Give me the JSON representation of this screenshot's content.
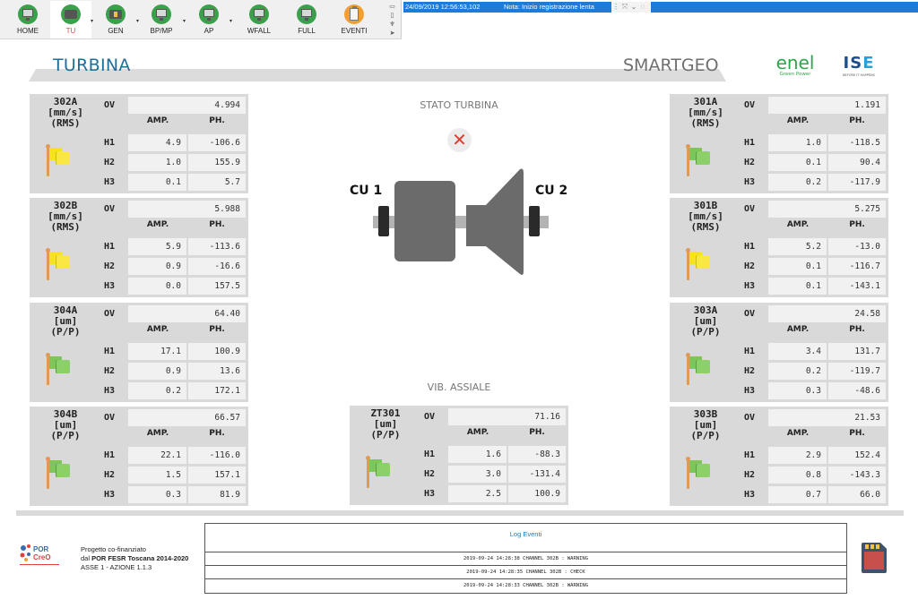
{
  "toolbar": {
    "buttons": [
      {
        "label": "HOME",
        "icon": "monitor-icon",
        "active": false,
        "dropdown": false
      },
      {
        "label": "TU",
        "icon": "turbine-icon",
        "active": true,
        "dropdown": true
      },
      {
        "label": "GEN",
        "icon": "generator-icon",
        "active": false,
        "dropdown": true
      },
      {
        "label": "BP/MP",
        "icon": "monitor-icon",
        "active": false,
        "dropdown": true
      },
      {
        "label": "AP",
        "icon": "monitor-icon",
        "active": false,
        "dropdown": true
      },
      {
        "label": "WFALL",
        "icon": "monitor-icon",
        "active": false,
        "dropdown": false
      },
      {
        "label": "FULL",
        "icon": "monitor-icon",
        "active": false,
        "dropdown": false
      },
      {
        "label": "EVENTI",
        "icon": "clipboard-icon",
        "active": false,
        "dropdown": false
      }
    ],
    "caret": "▾",
    "side_icons": [
      "keyboard-icon",
      "note-icon",
      "microphone-icon",
      "pointer-icon"
    ]
  },
  "statusbar": {
    "timestamp": "24/09/2019 12:56:53,102",
    "note": "Nota: Inizio registrazione lenta",
    "controls": [
      "grid-icon",
      "expand-icon",
      "chevron-down-icon",
      "chat-icon"
    ],
    "bg_color": "#1e7bd8"
  },
  "header": {
    "title": "TURBINA",
    "brand": "SMARTGEO",
    "enel_logo": "enel",
    "enel_sub": "Green Power",
    "ise_logo_a": "IS",
    "ise_logo_b": "E",
    "ise_sub": "BEFORE IT HAPPENS"
  },
  "labels": {
    "ov": "OV",
    "amp": "AMP.",
    "ph": "PH.",
    "h1": "H1",
    "h2": "H2",
    "h3": "H3"
  },
  "sensors": {
    "s302A": {
      "line1": "302A",
      "line2": "[mm/s]",
      "line3": "(RMS)",
      "flag": "yellow",
      "ov": "4.994",
      "h1_amp": "4.9",
      "h1_ph": "-106.6",
      "h2_amp": "1.0",
      "h2_ph": "155.9",
      "h3_amp": "0.1",
      "h3_ph": "5.7"
    },
    "s302B": {
      "line1": "302B",
      "line2": "[mm/s]",
      "line3": "(RMS)",
      "flag": "yellow",
      "ov": "5.988",
      "h1_amp": "5.9",
      "h1_ph": "-113.6",
      "h2_amp": "0.9",
      "h2_ph": "-16.6",
      "h3_amp": "0.0",
      "h3_ph": "157.5"
    },
    "s304A": {
      "line1": "304A",
      "line2": "[um]",
      "line3": "(P/P)",
      "flag": "green",
      "ov": "64.40",
      "h1_amp": "17.1",
      "h1_ph": "100.9",
      "h2_amp": "0.9",
      "h2_ph": "13.6",
      "h3_amp": "0.2",
      "h3_ph": "172.1"
    },
    "s304B": {
      "line1": "304B",
      "line2": "[um]",
      "line3": "(P/P)",
      "flag": "green",
      "ov": "66.57",
      "h1_amp": "22.1",
      "h1_ph": "-116.0",
      "h2_amp": "1.5",
      "h2_ph": "157.1",
      "h3_amp": "0.3",
      "h3_ph": "81.9"
    },
    "s301A": {
      "line1": "301A",
      "line2": "[mm/s]",
      "line3": "(RMS)",
      "flag": "green",
      "ov": "1.191",
      "h1_amp": "1.0",
      "h1_ph": "-118.5",
      "h2_amp": "0.1",
      "h2_ph": "90.4",
      "h3_amp": "0.2",
      "h3_ph": "-117.9"
    },
    "s301B": {
      "line1": "301B",
      "line2": "[mm/s]",
      "line3": "(RMS)",
      "flag": "yellow",
      "ov": "5.275",
      "h1_amp": "5.2",
      "h1_ph": "-13.0",
      "h2_amp": "0.1",
      "h2_ph": "-116.7",
      "h3_amp": "0.1",
      "h3_ph": "-143.1"
    },
    "s303A": {
      "line1": "303A",
      "line2": "[um]",
      "line3": "(P/P)",
      "flag": "green",
      "ov": "24.58",
      "h1_amp": "3.4",
      "h1_ph": "131.7",
      "h2_amp": "0.2",
      "h2_ph": "-119.7",
      "h3_amp": "0.3",
      "h3_ph": "-48.6"
    },
    "s303B": {
      "line1": "303B",
      "line2": "[um]",
      "line3": "(P/P)",
      "flag": "green",
      "ov": "21.53",
      "h1_amp": "2.9",
      "h1_ph": "152.4",
      "h2_amp": "0.8",
      "h2_ph": "-143.3",
      "h3_amp": "0.7",
      "h3_ph": "66.0"
    },
    "sZT301": {
      "line1": "ZT301",
      "line2": "[um]",
      "line3": "(P/P)",
      "flag": "green",
      "ov": "71.16",
      "h1_amp": "1.6",
      "h1_ph": "-88.3",
      "h2_amp": "3.0",
      "h2_ph": "-131.4",
      "h3_amp": "2.5",
      "h3_ph": "100.9"
    }
  },
  "center": {
    "stato_title": "STATO TURBINA",
    "stato_symbol": "✕",
    "stato_color": "#e53b2c",
    "cu1": "CU 1",
    "cu2": "CU 2",
    "vib_title": "VIB. ASSIALE"
  },
  "footer": {
    "por_line1": "Progetto co-finanziato",
    "por_line2a": "dal ",
    "por_line2b": "POR FESR Toscana 2014-2020",
    "por_line3": "ASSE 1 - AZIONE 1.1.3",
    "por_logo_a": "POR",
    "por_logo_b": "CreO",
    "log_title": "Log Eventi",
    "log_rows": [
      "2019-09-24 14:28:38 CHANNEL 302B : WARNING",
      "2019-09-24 14:28:35 CHANNEL 302B : CHECK",
      "2019-09-24 14:28:33 CHANNEL 302B : WARNING"
    ]
  },
  "flag_colors": {
    "yellow": "#f6e31c",
    "green": "#7ec65a"
  }
}
